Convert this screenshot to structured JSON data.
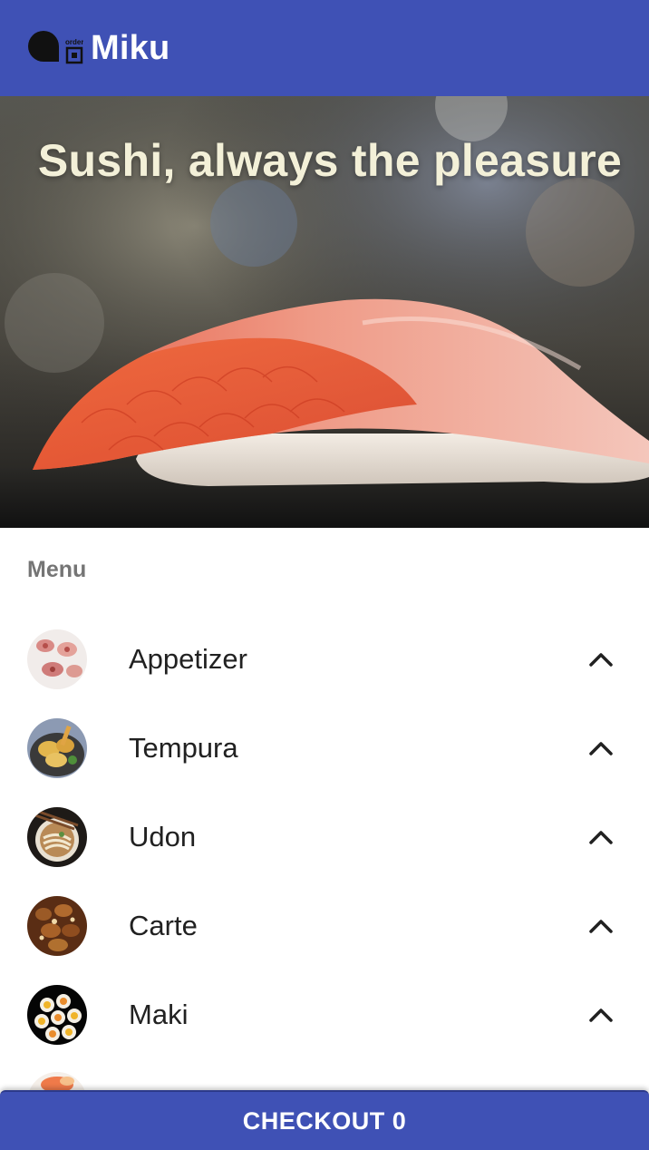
{
  "appbar": {
    "title": "Miku",
    "logo_text": "order",
    "background": "#3f51b5"
  },
  "hero": {
    "headline": "Sushi, always the pleasure",
    "image": "salmon-nigiri-photo"
  },
  "menu": {
    "heading": "Menu",
    "items": [
      {
        "label": "Appetizer",
        "icon": "chevron-up-icon"
      },
      {
        "label": "Tempura",
        "icon": "chevron-up-icon"
      },
      {
        "label": "Udon",
        "icon": "chevron-up-icon"
      },
      {
        "label": "Carte",
        "icon": "chevron-up-icon"
      },
      {
        "label": "Maki",
        "icon": "chevron-up-icon"
      }
    ]
  },
  "checkout": {
    "label": "CHECKOUT 0"
  }
}
